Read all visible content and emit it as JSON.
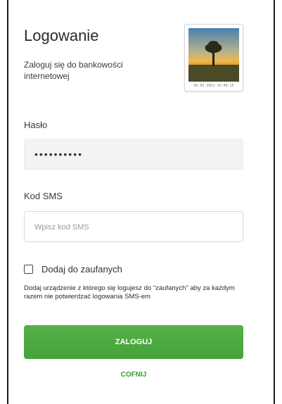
{
  "login": {
    "title": "Logowanie",
    "subtitle": "Zaloguj się do bankowości internetowej"
  },
  "security_image": {
    "icon": "tree-sunset-image",
    "timestamp": "05.03.2021 15:40:15"
  },
  "password": {
    "label": "Hasło",
    "value": "••••••••••"
  },
  "sms": {
    "label": "Kod SMS",
    "placeholder": "Wpisz kod SMS",
    "value": ""
  },
  "trusted": {
    "label": "Dodaj do zaufanych",
    "checked": false,
    "hint": "Dodaj urządzenie z którego się logujesz do \"zaufanych\" aby za każdym razem nie potwierdzać logowania SMS-em"
  },
  "actions": {
    "login_label": "ZALOGUJ",
    "back_label": "COFNIJ"
  },
  "colors": {
    "primary_green": "#4caa3f",
    "link_green": "#3a9a2f"
  }
}
